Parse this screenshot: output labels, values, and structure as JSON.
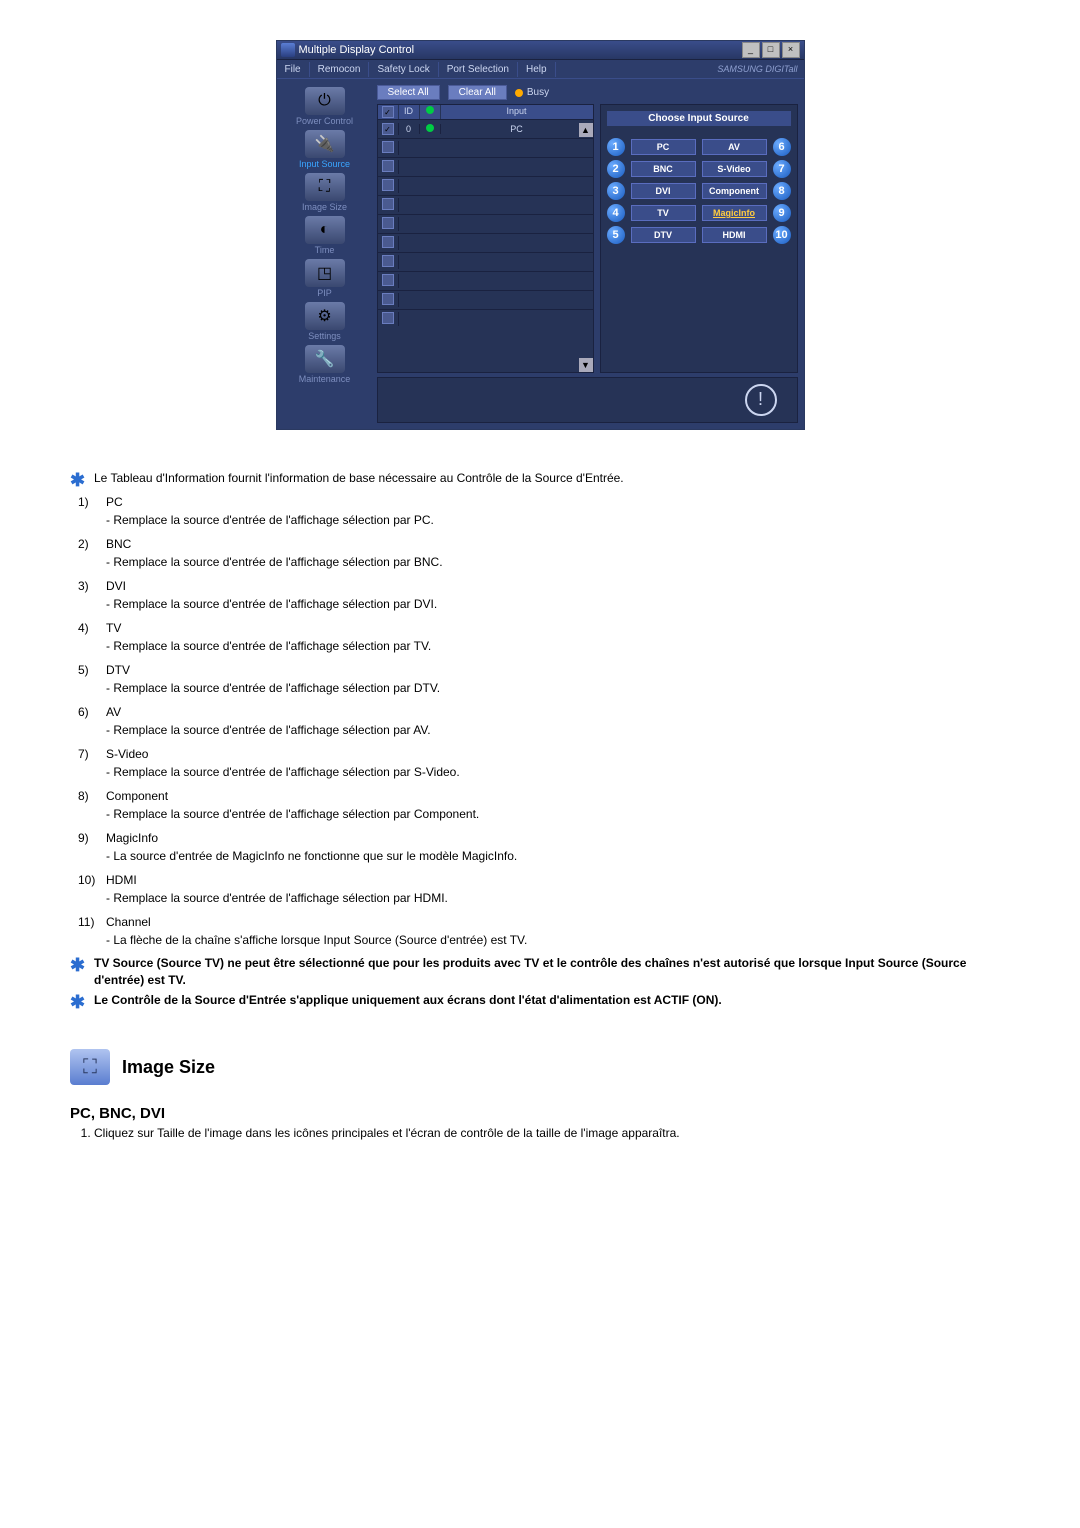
{
  "window": {
    "title": "Multiple Display Control",
    "menu": [
      "File",
      "Remocon",
      "Safety Lock",
      "Port Selection",
      "Help"
    ],
    "brand": "SAMSUNG DIGITall"
  },
  "sidebar": {
    "items": [
      {
        "label": "Power Control"
      },
      {
        "label": "Input Source"
      },
      {
        "label": "Image Size"
      },
      {
        "label": "Time"
      },
      {
        "label": "PIP"
      },
      {
        "label": "Settings"
      },
      {
        "label": "Maintenance"
      }
    ]
  },
  "toolbar": {
    "select_all": "Select All",
    "clear_all": "Clear All",
    "busy": "Busy"
  },
  "table": {
    "headers": {
      "check": "☑",
      "id": "ID",
      "dot": "●",
      "input": "Input"
    },
    "row0": {
      "id": "0",
      "input": "PC"
    }
  },
  "source_panel": {
    "title": "Choose Input Source",
    "left": [
      {
        "n": "1",
        "label": "PC"
      },
      {
        "n": "2",
        "label": "BNC"
      },
      {
        "n": "3",
        "label": "DVI"
      },
      {
        "n": "4",
        "label": "TV"
      },
      {
        "n": "5",
        "label": "DTV"
      }
    ],
    "right": [
      {
        "n": "6",
        "label": "AV"
      },
      {
        "n": "7",
        "label": "S-Video"
      },
      {
        "n": "8",
        "label": "Component"
      },
      {
        "n": "9",
        "label": "MagicInfo"
      },
      {
        "n": "10",
        "label": "HDMI"
      }
    ]
  },
  "doc": {
    "star_intro": "Le Tableau d'Information fournit l'information de base nécessaire au Contrôle de la Source d'Entrée.",
    "items": [
      {
        "n": "1)",
        "title": "PC",
        "desc": "- Remplace la source d'entrée de l'affichage sélection par PC."
      },
      {
        "n": "2)",
        "title": "BNC",
        "desc": "- Remplace la source d'entrée de l'affichage sélection par BNC."
      },
      {
        "n": "3)",
        "title": "DVI",
        "desc": "- Remplace la source d'entrée de l'affichage sélection par DVI."
      },
      {
        "n": "4)",
        "title": "TV",
        "desc": "- Remplace la source d'entrée de l'affichage sélection par TV."
      },
      {
        "n": "5)",
        "title": "DTV",
        "desc": "- Remplace la source d'entrée de l'affichage sélection par DTV."
      },
      {
        "n": "6)",
        "title": "AV",
        "desc": "- Remplace la source d'entrée de l'affichage sélection par AV."
      },
      {
        "n": "7)",
        "title": "S-Video",
        "desc": "- Remplace la source d'entrée de l'affichage sélection par S-Video."
      },
      {
        "n": "8)",
        "title": "Component",
        "desc": "- Remplace la source d'entrée de l'affichage sélection par Component."
      },
      {
        "n": "9)",
        "title": "MagicInfo",
        "desc": "- La source d'entrée de MagicInfo ne fonctionne que sur le modèle MagicInfo."
      },
      {
        "n": "10)",
        "title": "HDMI",
        "desc": "- Remplace la source d'entrée de l'affichage sélection par HDMI."
      },
      {
        "n": "11)",
        "title": "Channel",
        "desc": "- La flèche de la chaîne s'affiche lorsque Input Source (Source d'entrée) est TV."
      }
    ],
    "star_tv": "TV Source (Source TV) ne peut être sélectionné que pour les produits avec TV et le contrôle des chaînes n'est autorisé que lorsque Input Source (Source d'entrée) est TV.",
    "star_on": "Le Contrôle de la Source d'Entrée s'applique uniquement aux écrans dont l'état d'alimentation est ACTIF (ON).",
    "section_title": "Image Size",
    "subheading": "PC, BNC, DVI",
    "step1": "Cliquez sur Taille de l'image dans les icônes principales et l'écran de contrôle de la taille de l'image apparaîtra."
  }
}
